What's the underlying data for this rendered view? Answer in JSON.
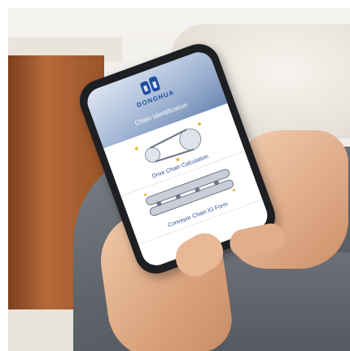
{
  "app": {
    "brand": "DONGHUA",
    "header_title": "Chain Identification"
  },
  "menu": [
    {
      "label": "Drive Chain Calculation"
    },
    {
      "label": "Conveyor Chain IG Form"
    }
  ],
  "colors": {
    "header": "#6c87b2",
    "brand_blue": "#1f4ea3",
    "chain_accent": "#e5b93a"
  }
}
